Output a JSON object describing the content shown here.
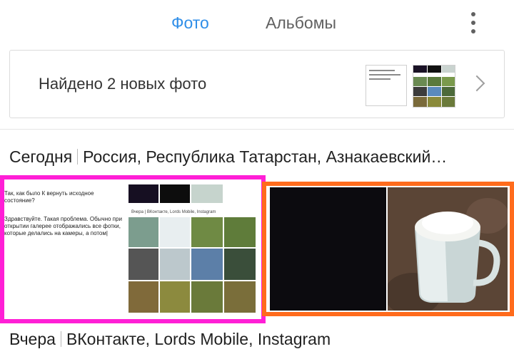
{
  "tabs": {
    "photos": "Фото",
    "albums": "Альбомы"
  },
  "banner": {
    "text": "Найдено 2 новых фото"
  },
  "today": {
    "date": "Сегодня",
    "place": "Россия, Республика Татарстан, Азнакаевский…"
  },
  "yesterday": {
    "date": "Вчера",
    "place": "ВКонтакте, Lords Mobile, Instagram"
  },
  "thumb_screenshot": {
    "question": "Так, как было К вернуть исходное состояние?",
    "body": "Здравствуйте. Такая проблема. Обычно при открытии галерее отображались все фотки, которые делались на камеры, а потом|",
    "inner_label": "Вчера | ВКонтакте, Lords Mobile, Instagram"
  },
  "colors": {
    "accent": "#2f8ee8",
    "highlight_magenta": "#ff1fd6",
    "highlight_orange": "#ff6b1c"
  },
  "icons": {
    "menu": "more-vert-icon",
    "chevron": "chevron-right-icon"
  }
}
